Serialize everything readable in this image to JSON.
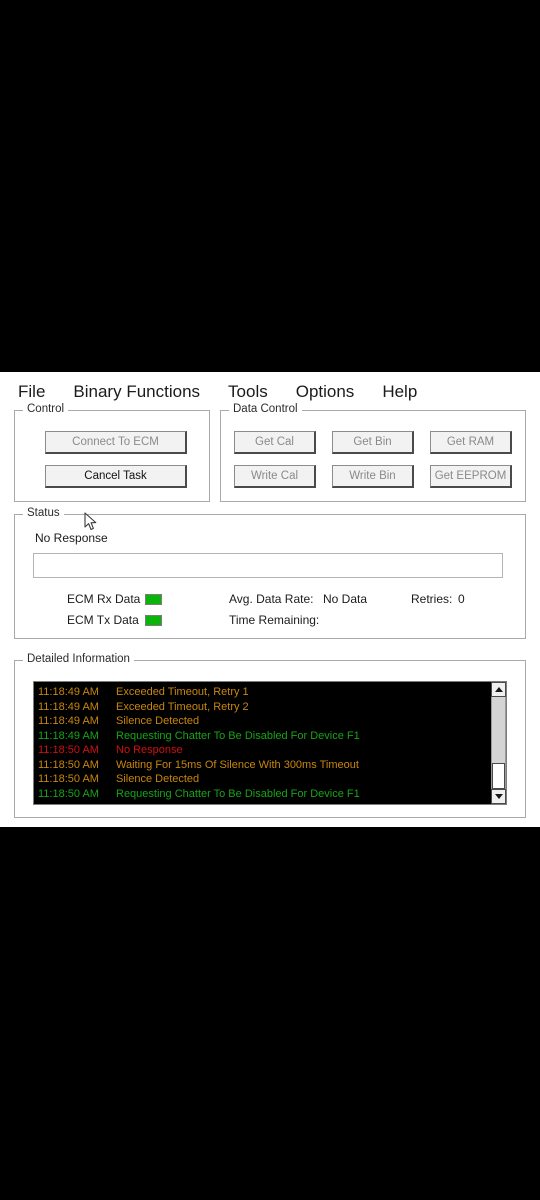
{
  "menu": {
    "items": [
      {
        "label": "File"
      },
      {
        "label": "Binary Functions"
      },
      {
        "label": "Tools"
      },
      {
        "label": "Options"
      },
      {
        "label": "Help"
      }
    ]
  },
  "control_group": {
    "title": "Control",
    "connect_button": "Connect To ECM",
    "cancel_button": "Cancel Task"
  },
  "data_control_group": {
    "title": "Data Control",
    "get_cal": "Get Cal",
    "get_bin": "Get Bin",
    "get_ram": "Get RAM",
    "write_cal": "Write Cal",
    "write_bin": "Write Bin",
    "get_eeprom": "Get EEPROM"
  },
  "status_group": {
    "title": "Status",
    "message": "No Response",
    "progress_value": "",
    "rx_label": "ECM Rx Data",
    "tx_label": "ECM Tx Data",
    "rate_label": "Avg. Data Rate:",
    "rate_value": "No Data",
    "time_remaining_label": "Time Remaining:",
    "time_remaining_value": "",
    "retries_label": "Retries:",
    "retries_value": "0",
    "led_color": "#0ab50a"
  },
  "detail_group": {
    "title": "Detailed Information",
    "colors": {
      "orange": "#c8860d",
      "green": "#17a417",
      "red": "#d01010",
      "background": "#000000"
    },
    "lines": [
      {
        "time": "11:18:49 AM",
        "message": "Exceeded Timeout, Retry 1",
        "color": "orange"
      },
      {
        "time": "11:18:49 AM",
        "message": "Exceeded Timeout, Retry 2",
        "color": "orange"
      },
      {
        "time": "11:18:49 AM",
        "message": "Silence Detected",
        "color": "orange"
      },
      {
        "time": "11:18:49 AM",
        "message": "Requesting Chatter To Be Disabled For Device F1",
        "color": "green"
      },
      {
        "time": "11:18:50 AM",
        "message": "No Response",
        "color": "red"
      },
      {
        "time": "11:18:50 AM",
        "message": "Waiting For 15ms Of Silence With 300ms Timeout",
        "color": "orange"
      },
      {
        "time": "11:18:50 AM",
        "message": "Silence Detected",
        "color": "orange"
      },
      {
        "time": "11:18:50 AM",
        "message": "Requesting Chatter To Be Disabled For Device F1",
        "color": "green"
      }
    ]
  }
}
